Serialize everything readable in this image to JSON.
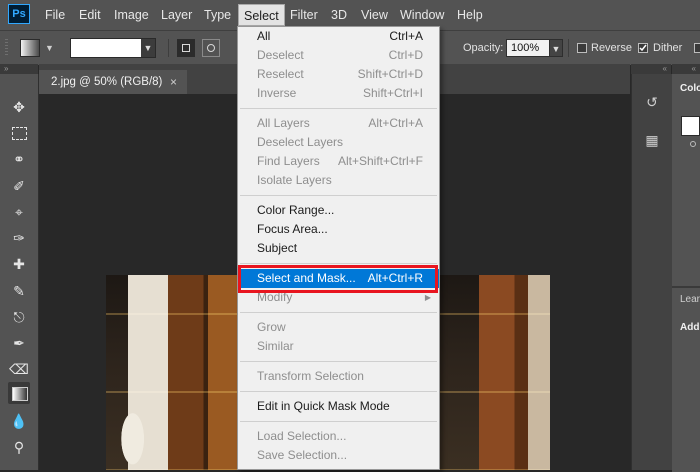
{
  "app": {
    "logo": "Ps"
  },
  "menubar": {
    "items": [
      "File",
      "Edit",
      "Image",
      "Layer",
      "Type",
      "Select",
      "Filter",
      "3D",
      "View",
      "Window",
      "Help"
    ],
    "active": "Select"
  },
  "options_bar": {
    "opacity_label": "Opacity:",
    "opacity_value": "100%",
    "reverse_label": "Reverse",
    "dither_label": "Dither",
    "dither_checked": true,
    "reverse_checked": false
  },
  "document": {
    "tab_title": "2.jpg @ 50% (RGB/8)",
    "close_glyph": "×"
  },
  "right_panel": {
    "color_tab": "Color",
    "learn_tab": "Learn",
    "lower_label": "Add"
  },
  "select_menu": {
    "groups": [
      [
        {
          "label": "All",
          "shortcut": "Ctrl+A",
          "enabled": true
        },
        {
          "label": "Deselect",
          "shortcut": "Ctrl+D",
          "enabled": false
        },
        {
          "label": "Reselect",
          "shortcut": "Shift+Ctrl+D",
          "enabled": false
        },
        {
          "label": "Inverse",
          "shortcut": "Shift+Ctrl+I",
          "enabled": false
        }
      ],
      [
        {
          "label": "All Layers",
          "shortcut": "Alt+Ctrl+A",
          "enabled": false
        },
        {
          "label": "Deselect Layers",
          "shortcut": "",
          "enabled": false
        },
        {
          "label": "Find Layers",
          "shortcut": "Alt+Shift+Ctrl+F",
          "enabled": false
        },
        {
          "label": "Isolate Layers",
          "shortcut": "",
          "enabled": false
        }
      ],
      [
        {
          "label": "Color Range...",
          "shortcut": "",
          "enabled": true
        },
        {
          "label": "Focus Area...",
          "shortcut": "",
          "enabled": true
        },
        {
          "label": "Subject",
          "shortcut": "",
          "enabled": true
        }
      ],
      [
        {
          "label": "Select and Mask...",
          "shortcut": "Alt+Ctrl+R",
          "enabled": true,
          "highlighted": true
        },
        {
          "label": "Modify",
          "shortcut": "",
          "enabled": false,
          "submenu": true
        }
      ],
      [
        {
          "label": "Grow",
          "shortcut": "",
          "enabled": false
        },
        {
          "label": "Similar",
          "shortcut": "",
          "enabled": false
        }
      ],
      [
        {
          "label": "Transform Selection",
          "shortcut": "",
          "enabled": false
        }
      ],
      [
        {
          "label": "Edit in Quick Mask Mode",
          "shortcut": "",
          "enabled": true
        }
      ],
      [
        {
          "label": "Load Selection...",
          "shortcut": "",
          "enabled": false
        },
        {
          "label": "Save Selection...",
          "shortcut": "",
          "enabled": false
        }
      ]
    ]
  },
  "colors": {
    "highlight": "#0078d7",
    "annotation_box": "#e8151f",
    "chrome": "#535353"
  },
  "tools": [
    "move-icon",
    "marquee-icon",
    "lasso-icon",
    "quick-select-icon",
    "crop-icon",
    "eyedropper-icon",
    "healing-brush-icon",
    "brush-icon",
    "clone-stamp-icon",
    "history-brush-icon",
    "eraser-icon",
    "gradient-icon",
    "blur-icon",
    "dodge-icon"
  ]
}
